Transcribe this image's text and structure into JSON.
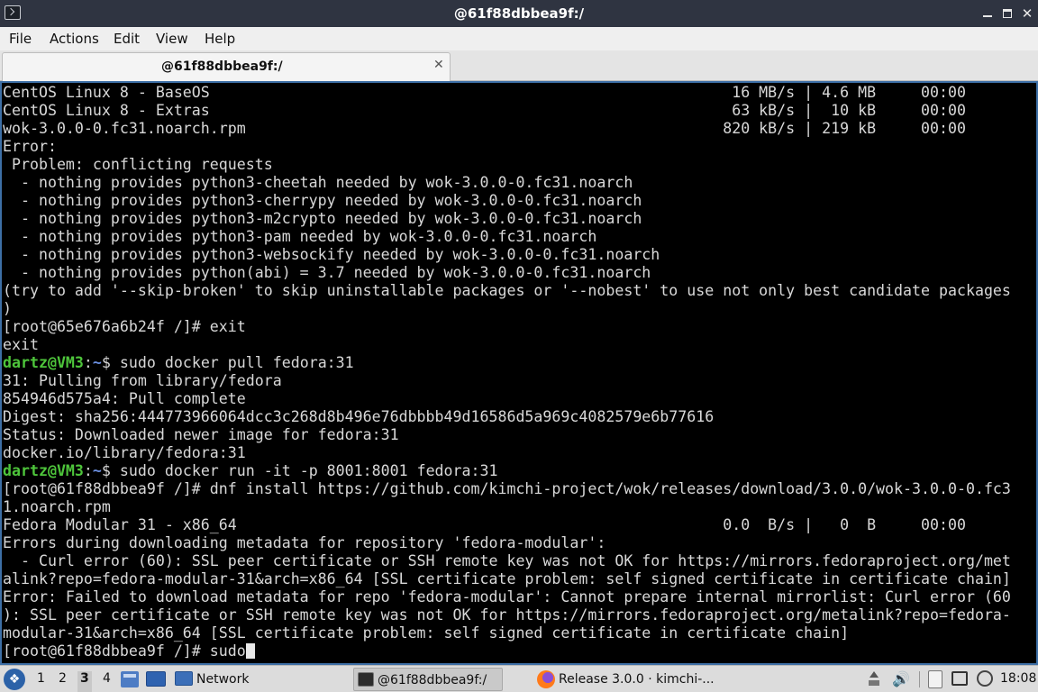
{
  "window": {
    "title": "@61f88dbbea9f:/",
    "minimize_label": "Minimize",
    "maximize_label": "Maximize",
    "close_glyph": "✕"
  },
  "menu": {
    "items": [
      "File",
      "Actions",
      "Edit",
      "View",
      "Help"
    ]
  },
  "tab": {
    "title": "@61f88dbbea9f:/",
    "close_glyph": "✕"
  },
  "terminal": {
    "lines": [
      "CentOS Linux 8 - BaseOS                                                          16 MB/s | 4.6 MB     00:00",
      "CentOS Linux 8 - Extras                                                          63 kB/s |  10 kB     00:00",
      "wok-3.0.0-0.fc31.noarch.rpm                                                     820 kB/s | 219 kB     00:00",
      "Error: ",
      " Problem: conflicting requests",
      "  - nothing provides python3-cheetah needed by wok-3.0.0-0.fc31.noarch",
      "  - nothing provides python3-cherrypy needed by wok-3.0.0-0.fc31.noarch",
      "  - nothing provides python3-m2crypto needed by wok-3.0.0-0.fc31.noarch",
      "  - nothing provides python3-pam needed by wok-3.0.0-0.fc31.noarch",
      "  - nothing provides python3-websockify needed by wok-3.0.0-0.fc31.noarch",
      "  - nothing provides python(abi) = 3.7 needed by wok-3.0.0-0.fc31.noarch",
      "(try to add '--skip-broken' to skip uninstallable packages or '--nobest' to use not only best candidate packages",
      ")",
      "[root@65e676a6b24f /]# exit",
      "exit",
      null,
      "31: Pulling from library/fedora",
      "854946d575a4: Pull complete",
      "Digest: sha256:444773966064dcc3c268d8b496e76dbbbb49d16586d5a969c4082579e6b77616",
      "Status: Downloaded newer image for fedora:31",
      "docker.io/library/fedora:31",
      null,
      "[root@61f88dbbea9f /]# dnf install https://github.com/kimchi-project/wok/releases/download/3.0.0/wok-3.0.0-0.fc3",
      "1.noarch.rpm",
      "Fedora Modular 31 - x86_64                                                      0.0  B/s |   0  B     00:00",
      "Errors during downloading metadata for repository 'fedora-modular':",
      "  - Curl error (60): SSL peer certificate or SSH remote key was not OK for https://mirrors.fedoraproject.org/met",
      "alink?repo=fedora-modular-31&arch=x86_64 [SSL certificate problem: self signed certificate in certificate chain]",
      "Error: Failed to download metadata for repo 'fedora-modular': Cannot prepare internal mirrorlist: Curl error (60",
      "): SSL peer certificate or SSH remote key was not OK for https://mirrors.fedoraproject.org/metalink?repo=fedora-",
      "modular-31&arch=x86_64 [SSL certificate problem: self signed certificate in certificate chain]"
    ],
    "prompt_user": "dartz@VM3",
    "prompt_path": "~",
    "cmd1": "$ sudo docker pull fedora:31",
    "cmd2": "$ sudo docker run -it -p 8001:8001 fedora:31",
    "last_prompt": "[root@61f88dbbea9f /]# ",
    "current_input": "sudo"
  },
  "taskbar": {
    "start_glyph": "❖",
    "workspaces": [
      "1",
      "2",
      "3",
      "4"
    ],
    "active_workspace": "3",
    "tasks": [
      {
        "label": "Network",
        "icon": "folder-icon"
      },
      {
        "label": "@61f88dbbea9f:/",
        "icon": "terminal-icon"
      },
      {
        "label": "Release 3.0.0 · kimchi-...",
        "icon": "firefox-icon"
      }
    ],
    "volume_glyph": "🔊",
    "clock": "18:08"
  }
}
